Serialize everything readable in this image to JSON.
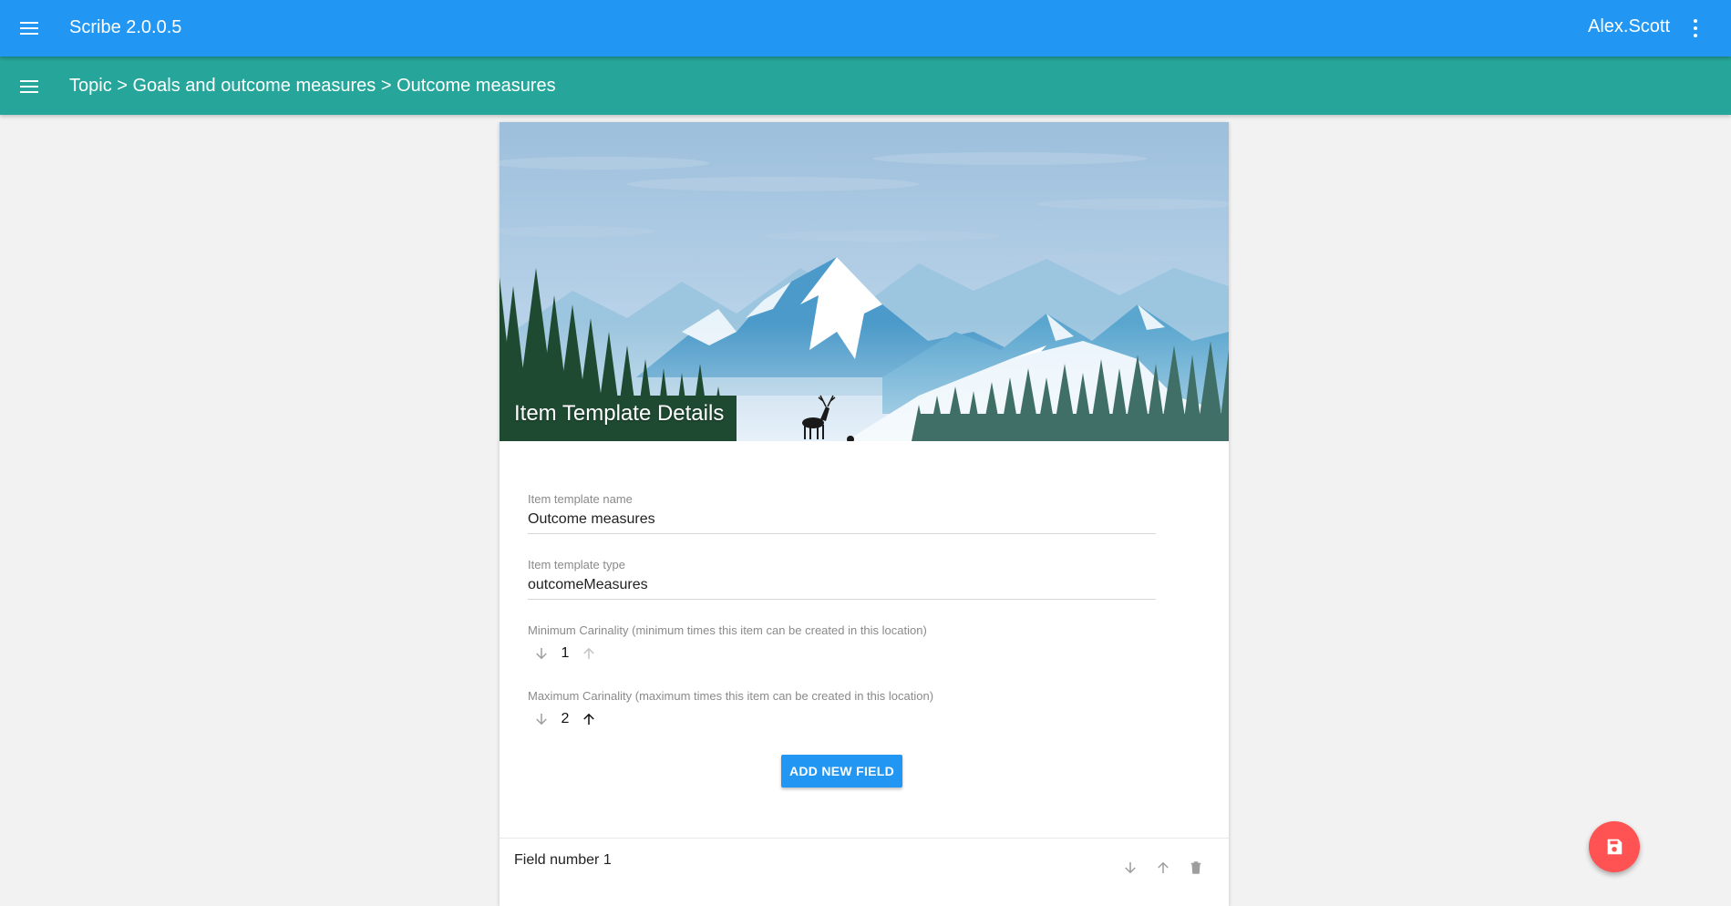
{
  "appbar": {
    "title": "Scribe 2.0.0.5",
    "user": "Alex.Scott"
  },
  "breadcrumb": "Topic > Goals and outcome measures > Outcome measures",
  "card": {
    "title": "Item Template Details",
    "name_label": "Item template name",
    "name_value": "Outcome measures",
    "type_label": "Item template type",
    "type_value": "outcomeMeasures",
    "min_label": "Minimum Carinality (minimum times this item can be created in this location)",
    "min_value": "1",
    "max_label": "Maximum Carinality (maximum times this item can be created in this location)",
    "max_value": "2",
    "add_button": "ADD NEW FIELD",
    "field_row": "Field number 1"
  },
  "colors": {
    "appbar": "#2196f3",
    "subbar": "#26a69a",
    "fab": "#ff5252"
  },
  "icons": [
    "menu-icon",
    "more-vert-icon",
    "arrow-down-icon",
    "arrow-up-icon",
    "delete-icon",
    "save-icon"
  ]
}
